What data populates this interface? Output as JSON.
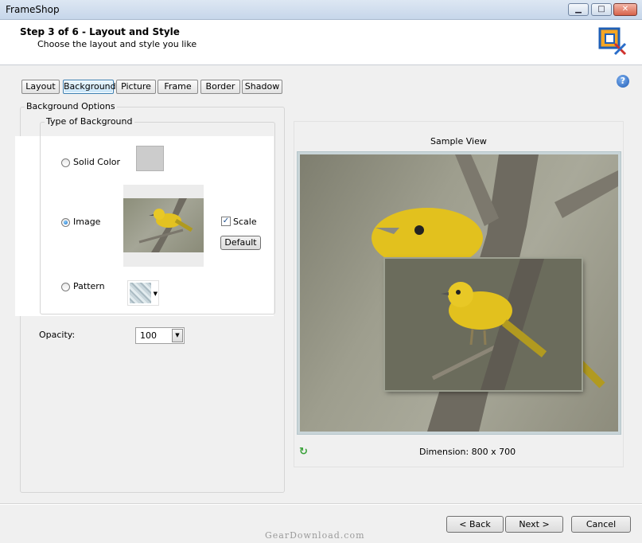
{
  "window": {
    "title": "FrameShop",
    "minimize_glyph": "▁",
    "maximize_glyph": "□",
    "close_glyph": "✕"
  },
  "header": {
    "step_title": "Step 3 of 6 - Layout and Style",
    "step_subtitle": "Choose the layout and style you like",
    "logo_icon": "frameshop-logo-icon"
  },
  "help": {
    "glyph": "?"
  },
  "tabs": [
    {
      "label": "Layout",
      "active": false
    },
    {
      "label": "Background",
      "active": true
    },
    {
      "label": "Picture",
      "active": false
    },
    {
      "label": "Frame",
      "active": false
    },
    {
      "label": "Border",
      "active": false
    },
    {
      "label": "Shadow",
      "active": false
    }
  ],
  "background_options": {
    "legend": "Background Options",
    "type_legend": "Type of Background",
    "solid_color": {
      "label": "Solid Color",
      "selected": false,
      "color": "#cccccc"
    },
    "image": {
      "label": "Image",
      "selected": true
    },
    "scale": {
      "label": "Scale",
      "checked": true,
      "mark": "✓"
    },
    "default_button": "Default",
    "pattern": {
      "label": "Pattern",
      "selected": false,
      "arrow": "▼"
    },
    "opacity": {
      "label": "Opacity:",
      "value": "100",
      "arrow": "▼"
    }
  },
  "sample": {
    "label": "Sample View",
    "dimension": "Dimension: 800 x 700",
    "refresh_glyph": "↻"
  },
  "footer": {
    "back": "< Back",
    "next": "Next >",
    "cancel": "Cancel"
  },
  "watermark": "GearDownload.com"
}
